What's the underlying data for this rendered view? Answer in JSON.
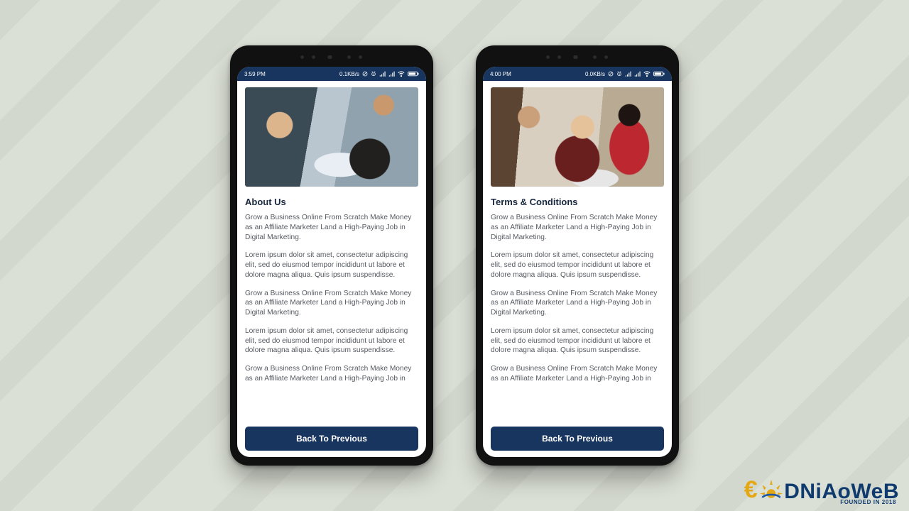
{
  "phones": [
    {
      "status": {
        "time": "3:59 PM",
        "net": "0.1KB/s"
      },
      "title": "About Us",
      "button": "Back To Previous",
      "paragraphs": [
        "Grow a Business Online From Scratch Make Money as an Affiliate Marketer Land a High-Paying Job in Digital Marketing.",
        "Lorem ipsum dolor sit amet, consectetur adipiscing elit, sed do eiusmod tempor incididunt ut labore et dolore magna aliqua. Quis ipsum suspendisse.",
        "Grow a Business Online From Scratch Make Money as an Affiliate Marketer Land a High-Paying Job in Digital Marketing.",
        "Lorem ipsum dolor sit amet, consectetur adipiscing elit, sed do eiusmod tempor incididunt ut labore et dolore magna aliqua. Quis ipsum suspendisse.",
        "Grow a Business Online From Scratch Make Money as an Affiliate Marketer Land a High-Paying Job in"
      ]
    },
    {
      "status": {
        "time": "4:00 PM",
        "net": "0.0KB/s"
      },
      "title": "Terms & Conditions",
      "button": "Back To Previous",
      "paragraphs": [
        "Grow a Business Online From Scratch Make Money as an Affiliate Marketer Land a High-Paying Job in Digital Marketing.",
        "Lorem ipsum dolor sit amet, consectetur adipiscing elit, sed do eiusmod tempor incididunt ut labore et dolore magna aliqua. Quis ipsum suspendisse.",
        "Grow a Business Online From Scratch Make Money as an Affiliate Marketer Land a High-Paying Job in Digital Marketing.",
        "Lorem ipsum dolor sit amet, consectetur adipiscing elit, sed do eiusmod tempor incididunt ut labore et dolore magna aliqua. Quis ipsum suspendisse.",
        "Grow a Business Online From Scratch Make Money as an Affiliate Marketer Land a High-Paying Job in"
      ]
    }
  ],
  "watermark": {
    "brand": "DNiAoWeB",
    "tagline": "FOUNDED IN 2018"
  }
}
